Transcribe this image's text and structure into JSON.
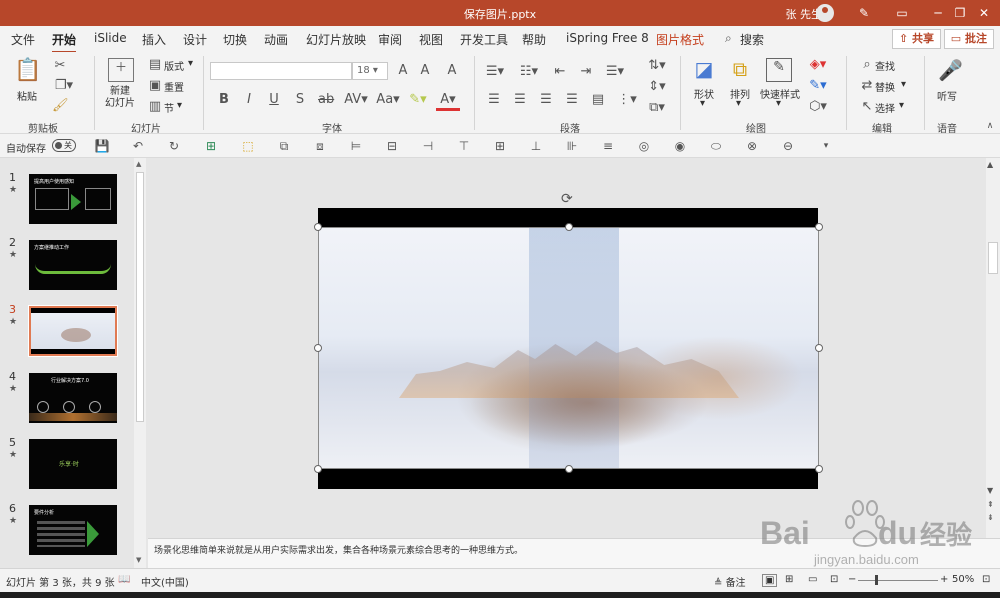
{
  "window": {
    "title": "保存图片.pptx",
    "user": "张 先生"
  },
  "tabs": [
    {
      "label": "文件",
      "active": false
    },
    {
      "label": "开始",
      "active": true
    },
    {
      "label": "iSlide",
      "active": false
    },
    {
      "label": "插入",
      "active": false
    },
    {
      "label": "设计",
      "active": false
    },
    {
      "label": "切换",
      "active": false
    },
    {
      "label": "动画",
      "active": false
    },
    {
      "label": "幻灯片放映",
      "active": false
    },
    {
      "label": "审阅",
      "active": false
    },
    {
      "label": "视图",
      "active": false
    },
    {
      "label": "开发工具",
      "active": false
    },
    {
      "label": "帮助",
      "active": false
    },
    {
      "label": "iSpring Free 8",
      "active": false
    },
    {
      "label": "图片格式",
      "active": false,
      "contextual": true
    }
  ],
  "search": {
    "label": "搜索"
  },
  "actions": {
    "share": "共享",
    "comment": "批注"
  },
  "ribbon": {
    "clipboard": {
      "group": "剪贴板",
      "paste": "粘贴"
    },
    "slides": {
      "group": "幻灯片",
      "new_slide": "新建\n幻灯片",
      "layout": "版式",
      "reset": "重置",
      "section": "节"
    },
    "font": {
      "group": "字体",
      "font_name": "",
      "font_size": "18"
    },
    "paragraph": {
      "group": "段落"
    },
    "drawing": {
      "group": "绘图",
      "shapes": "形状",
      "arrange": "排列",
      "quick_styles": "快速样式"
    },
    "editing": {
      "group": "编辑",
      "find": "查找",
      "replace": "替换",
      "select": "选择"
    },
    "voice": {
      "group": "语音",
      "dictate": "听写"
    }
  },
  "qat": {
    "autosave": "自动保存",
    "autosave_state": "关"
  },
  "thumbnails": [
    {
      "num": "1",
      "star": "★",
      "text": "提高用户使用感知"
    },
    {
      "num": "2",
      "star": "★",
      "text": "方案继推动工作"
    },
    {
      "num": "3",
      "star": "★",
      "text": ""
    },
    {
      "num": "4",
      "star": "★",
      "text": "行业解决方案7.0"
    },
    {
      "num": "5",
      "star": "★",
      "text": "乐享·时"
    },
    {
      "num": "6",
      "star": "★",
      "text": "要件分析"
    }
  ],
  "active_slide": 3,
  "notes": "场景化思维简单来说就是从用户实际需求出发，集合各种场景元素综合思考的一种思维方式。",
  "status": {
    "slide_info": "幻灯片 第 3 张，共 9 张",
    "language": "中文(中国)",
    "notes_btn": "备注",
    "zoom": "50%"
  },
  "watermark": {
    "brand": "Bai",
    "brand_tail": "du",
    "cn": "经验",
    "url": "jingyan.baidu.com"
  },
  "colors": {
    "accent": "#b7472a",
    "contextual_tab": "#c43e1c"
  }
}
